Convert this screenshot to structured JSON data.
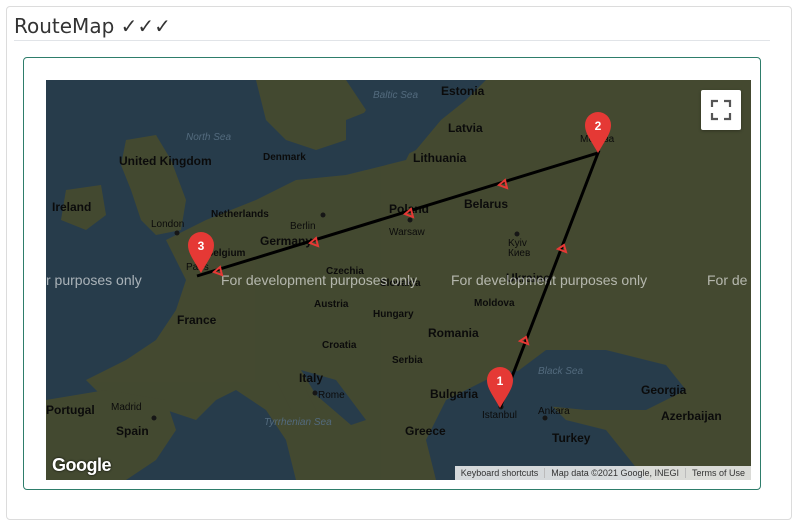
{
  "page_title": "RouteMap ✓✓✓",
  "map": {
    "watermark": "For development purposes only",
    "watermark_left": "r purposes only",
    "watermark_right": "For de",
    "google_logo": "Google",
    "attribution": {
      "shortcuts": "Keyboard shortcuts",
      "data": "Map data ©2021 Google, INEGI",
      "terms": "Terms of Use"
    },
    "fullscreen_icon": "fullscreen-icon",
    "route_color": "#000000",
    "marker_color": "#e53935",
    "markers": [
      {
        "label": "1",
        "city": "Istanbul"
      },
      {
        "label": "2",
        "city": "Moscow"
      },
      {
        "label": "3",
        "city": "Paris"
      }
    ],
    "labels": {
      "countries": [
        "United Kingdom",
        "Ireland",
        "Netherlands",
        "Denmark",
        "Germany",
        "Belgium",
        "France",
        "Czechia",
        "Slovakia",
        "Austria",
        "Hungary",
        "Poland",
        "Lithuania",
        "Latvia",
        "Estonia",
        "Belarus",
        "Ukraine",
        "Moldova",
        "Romania",
        "Serbia",
        "Croatia",
        "Italy",
        "Bulgaria",
        "Greece",
        "Turkey",
        "Georgia",
        "Azerbaijan",
        "Spain",
        "Portugal"
      ],
      "cities": [
        "London",
        "Berlin",
        "Paris",
        "Warsaw",
        "Kyiv",
        "Rome",
        "Madrid",
        "Istanbul",
        "Ankara",
        "Moscow"
      ],
      "cities_native": [
        "Киев",
        "Москва"
      ],
      "seas": [
        "North Sea",
        "Baltic Sea",
        "Black Sea",
        "Tyrrhenian Sea"
      ]
    }
  }
}
